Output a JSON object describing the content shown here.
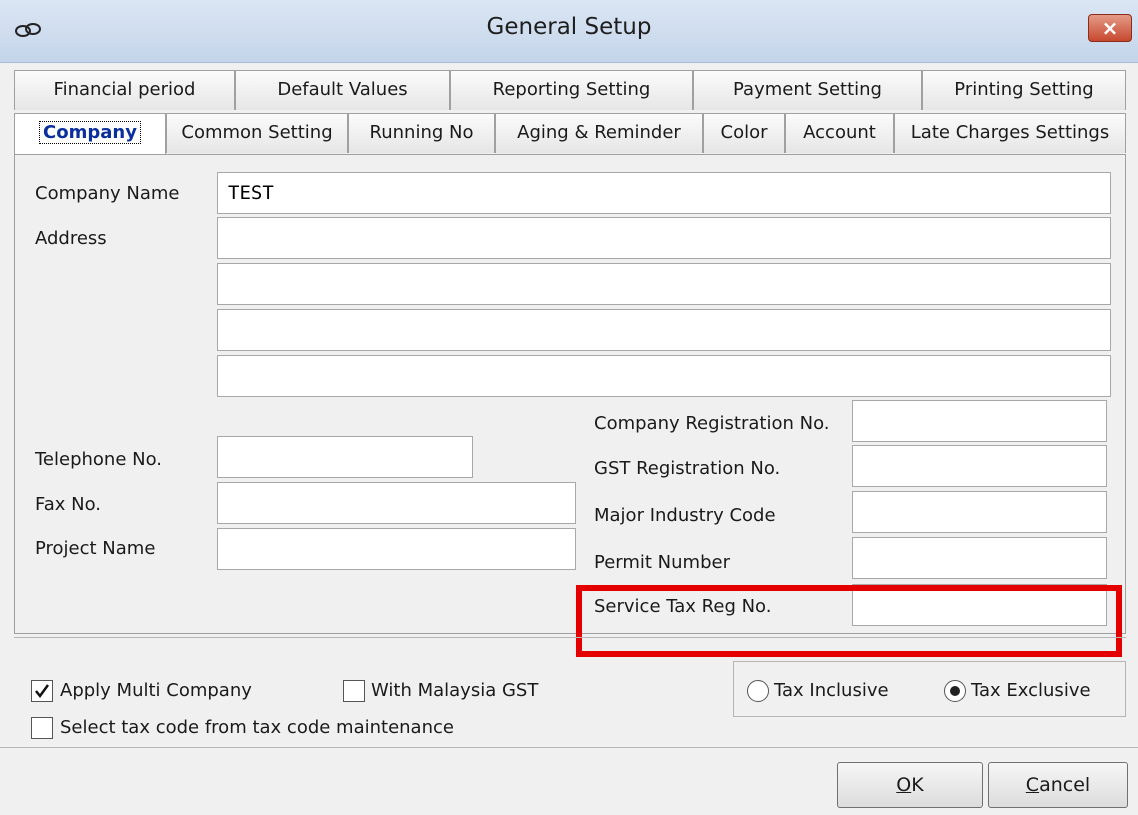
{
  "window": {
    "title": "General Setup",
    "close_label": "×"
  },
  "tabs_row1": [
    {
      "label": "Financial period"
    },
    {
      "label": "Default Values"
    },
    {
      "label": "Reporting Setting"
    },
    {
      "label": "Payment Setting"
    },
    {
      "label": "Printing Setting"
    }
  ],
  "tabs_row2": [
    {
      "label": "Company"
    },
    {
      "label": "Common Setting"
    },
    {
      "label": "Running No"
    },
    {
      "label": "Aging & Reminder"
    },
    {
      "label": "Color"
    },
    {
      "label": "Account"
    },
    {
      "label": "Late Charges Settings"
    }
  ],
  "form": {
    "company_name_label": "Company Name",
    "company_name_value": "TEST",
    "address_label": "Address",
    "address_lines": [
      "",
      "",
      "",
      ""
    ],
    "telephone_label": "Telephone No.",
    "telephone_value": "",
    "fax_label": "Fax No.",
    "fax_value": "",
    "project_label": "Project Name",
    "project_value": "",
    "company_reg_label": "Company Registration No.",
    "company_reg_value": "",
    "gst_reg_label": "GST Registration No.",
    "gst_reg_value": "",
    "industry_code_label": "Major Industry Code",
    "industry_code_value": "",
    "permit_label": "Permit Number",
    "permit_value": "",
    "service_tax_label": "Service Tax Reg No.",
    "service_tax_value": ""
  },
  "options": {
    "apply_multi_company_label": "Apply Multi Company",
    "apply_multi_company_checked": true,
    "with_gst_label": "With Malaysia GST",
    "with_gst_checked": false,
    "select_tax_code_label": "Select tax code from tax code maintenance",
    "select_tax_code_checked": false,
    "tax_inclusive_label": "Tax Inclusive",
    "tax_exclusive_label": "Tax Exclusive",
    "tax_mode_selected": "Tax Exclusive"
  },
  "buttons": {
    "ok_label": "OK",
    "ok_mnemonic": "O",
    "ok_rest": "K",
    "cancel_label": "Cancel",
    "cancel_mnemonic": "C",
    "cancel_rest": "ancel"
  },
  "colors": {
    "highlight": "#e50000",
    "active_tab_text": "#0a2f9c",
    "close_button": "#c8492f"
  }
}
